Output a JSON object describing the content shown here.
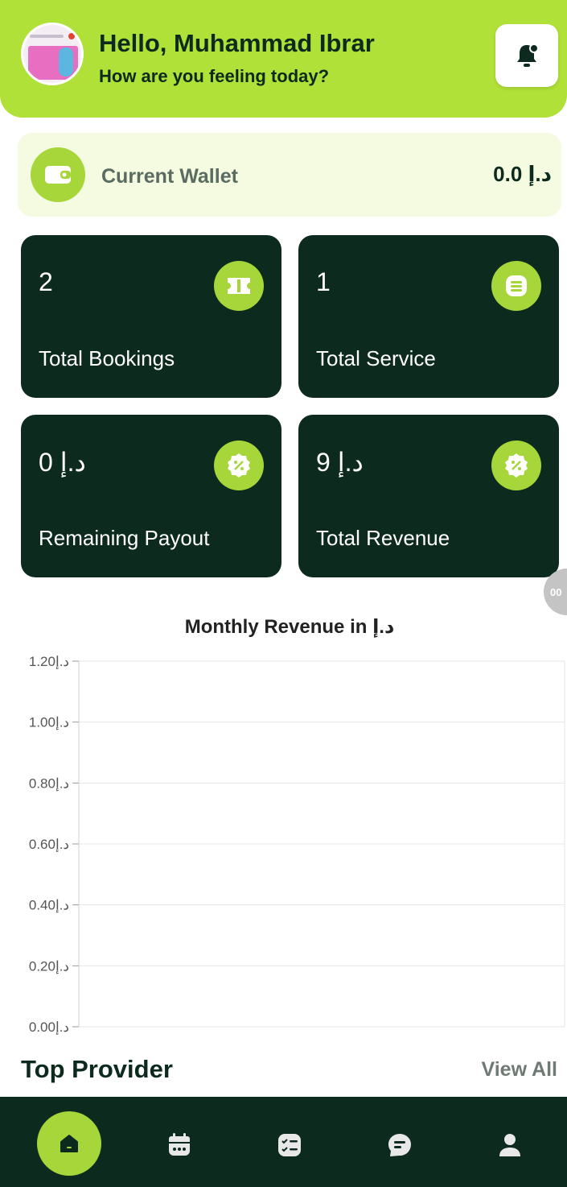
{
  "header": {
    "greeting": "Hello, Muhammad Ibrar",
    "subtitle": "How are you feeling today?"
  },
  "wallet": {
    "label": "Current Wallet",
    "amount": "د.إ 0.0"
  },
  "stats": [
    {
      "value": "2",
      "label": "Total Bookings",
      "icon": "ticket-icon"
    },
    {
      "value": "1",
      "label": "Total Service",
      "icon": "list-icon"
    },
    {
      "value": "د.إ 0",
      "label": "Remaining Payout",
      "icon": "discount-badge-icon"
    },
    {
      "value": "د.إ 9",
      "label": "Total Revenue",
      "icon": "discount-badge-icon"
    }
  ],
  "floating_badge": "00",
  "chart_data": {
    "type": "line",
    "title": "Monthly Revenue in د.إ",
    "yticks": [
      "1.20د.إ",
      "1.00د.إ",
      "0.80د.إ",
      "0.60د.إ",
      "0.40د.إ",
      "0.20د.إ",
      "0.00د.إ"
    ],
    "ylim": [
      0,
      1.2
    ],
    "series": [],
    "grid": true
  },
  "top_provider": {
    "title": "Top Provider",
    "view_all": "View All"
  },
  "nav": {
    "items": [
      "home-icon",
      "calendar-icon",
      "checklist-icon",
      "chat-icon",
      "profile-icon"
    ]
  },
  "colors": {
    "accent": "#b0e138",
    "accent_icon": "#a6d63a",
    "dark": "#0d2a1f",
    "wallet_bg": "#f4fbe0"
  }
}
